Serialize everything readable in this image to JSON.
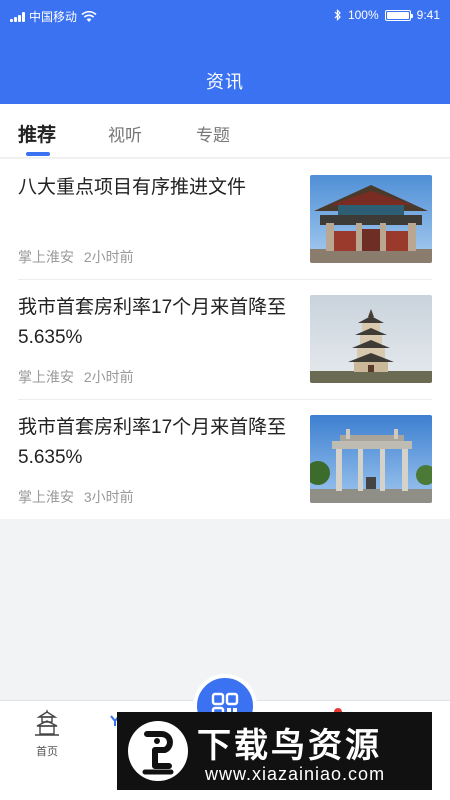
{
  "status_bar": {
    "carrier": "中国移动",
    "battery": "100%",
    "time": "9:41",
    "signal_icon": "signal-icon",
    "wifi_icon": "wifi-icon",
    "bluetooth_icon": "bluetooth-icon",
    "battery_level": 1.0
  },
  "header": {
    "title": "资讯"
  },
  "tabs": [
    {
      "label": "推荐",
      "active": true
    },
    {
      "label": "视听",
      "active": false
    },
    {
      "label": "专题",
      "active": false
    }
  ],
  "articles": [
    {
      "title": "八大重点项目有序推进文件",
      "source": "掌上淮安",
      "time": "2小时前",
      "thumb": "archway-image"
    },
    {
      "title": "我市首套房利率17个月来首降至5.635%",
      "source": "掌上淮安",
      "time": "2小时前",
      "thumb": "pagoda-image"
    },
    {
      "title": "我市首套房利率17个月来首降至5.635%",
      "source": "掌上淮安",
      "time": "3小时前",
      "thumb": "memorial-gate-image"
    }
  ],
  "bottom_nav": {
    "home_label": "首页",
    "home_icon": "pagoda-home-icon",
    "center_icon": "qr-scan-icon"
  },
  "watermark": {
    "title": "下载鸟资源",
    "url": "www.xiazainiao.com"
  },
  "colors": {
    "primary": "#3a72f2",
    "background": "#f2f3f5",
    "text": "#222222",
    "muted": "#9a9a9a"
  }
}
